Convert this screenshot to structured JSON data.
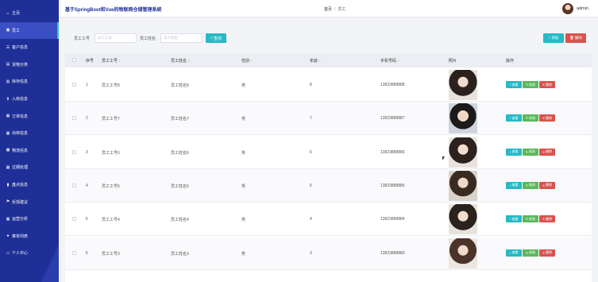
{
  "app": {
    "title": "基于SpringBoot和Vue的物联网仓储管理系统"
  },
  "sidebar": {
    "items": [
      {
        "label": "主页",
        "icon": "home-icon",
        "glyph": "⌂"
      },
      {
        "label": "员工",
        "icon": "user-icon",
        "glyph": "▣"
      },
      {
        "label": "客户信息",
        "icon": "customer-icon",
        "glyph": "☰"
      },
      {
        "label": "货物分类",
        "icon": "category-icon",
        "glyph": "▤"
      },
      {
        "label": "库存信息",
        "icon": "stock-icon",
        "glyph": "▥"
      },
      {
        "label": "入库信息",
        "icon": "inbound-icon",
        "glyph": "⬇"
      },
      {
        "label": "订单信息",
        "icon": "order-icon",
        "glyph": "▦"
      },
      {
        "label": "出库信息",
        "icon": "outbound-icon",
        "glyph": "▦"
      },
      {
        "label": "物流信息",
        "icon": "logistics-icon",
        "glyph": "▩"
      },
      {
        "label": "过期处理",
        "icon": "expire-icon",
        "glyph": "▦"
      },
      {
        "label": "盘点信息",
        "icon": "inventory-icon",
        "glyph": "▮"
      },
      {
        "label": "反馈建议",
        "icon": "feedback-icon",
        "glyph": "⚑"
      },
      {
        "label": "运营分析",
        "icon": "analysis-icon",
        "glyph": "▦"
      },
      {
        "label": "菜单列表",
        "icon": "menu-icon",
        "glyph": "●"
      },
      {
        "label": "个人中心",
        "icon": "profile-icon",
        "glyph": "▭"
      }
    ],
    "active_index": 1
  },
  "header": {
    "breadcrumb": {
      "home": "首页",
      "separator": "/",
      "current": "员工"
    },
    "user_name": "admin"
  },
  "search": {
    "label1": "员工工号",
    "placeholder1": "员工工号",
    "label2": "员工姓名",
    "placeholder2": "员工姓名",
    "button": "查询",
    "add_button": "+ 添加",
    "delete_button": "删除"
  },
  "table": {
    "columns": [
      "序号",
      "员工工号",
      "员工姓名",
      "性别",
      "年龄",
      "手机号码",
      "照片",
      "操作"
    ],
    "rows": [
      {
        "index": "1",
        "emp_no": "员工工号8",
        "name": "员工姓名8",
        "gender": "男",
        "age": "8",
        "phone": "13823888888"
      },
      {
        "index": "2",
        "emp_no": "员工工号7",
        "name": "员工姓名7",
        "gender": "男",
        "age": "7",
        "phone": "13823888887"
      },
      {
        "index": "3",
        "emp_no": "员工工号6",
        "name": "员工姓名6",
        "gender": "男",
        "age": "6",
        "phone": "13823888886"
      },
      {
        "index": "4",
        "emp_no": "员工工号5",
        "name": "员工姓名5",
        "gender": "男",
        "age": "5",
        "phone": "13823888885"
      },
      {
        "index": "5",
        "emp_no": "员工工号4",
        "name": "员工姓名4",
        "gender": "男",
        "age": "4",
        "phone": "13823888884"
      },
      {
        "index": "6",
        "emp_no": "员工工号3",
        "name": "员工姓名3",
        "gender": "男",
        "age": "3",
        "phone": "13823888883"
      }
    ],
    "actions": {
      "view": "查看",
      "edit": "修改",
      "delete": "删除"
    }
  },
  "colors": {
    "sidebar_bg": "#1e2f97",
    "accent": "#27b9c6",
    "danger": "#d9534f",
    "success": "#5cb85c"
  }
}
